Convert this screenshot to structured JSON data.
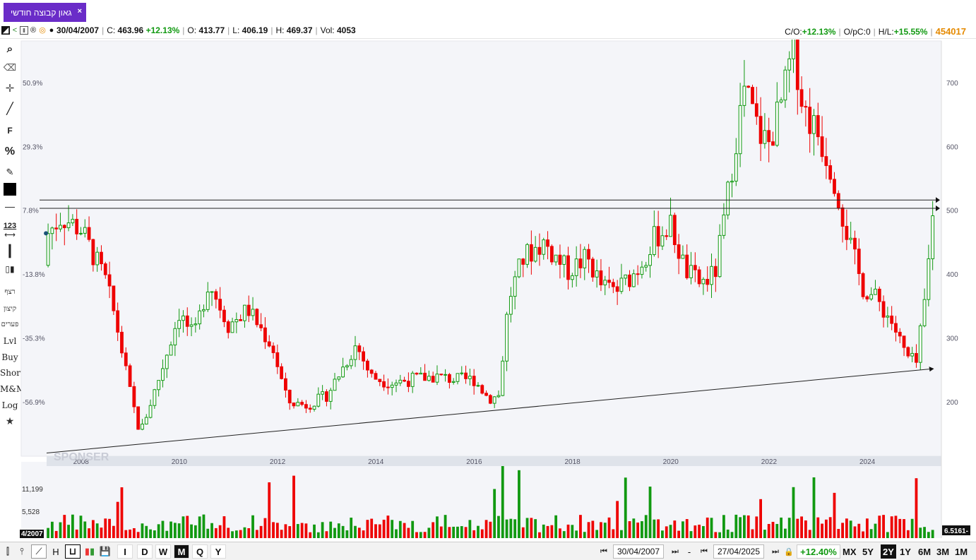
{
  "tab": {
    "title": "גאון קבוצה חודשי",
    "close": "×"
  },
  "info": {
    "date": "30/04/2007",
    "close_label": "C:",
    "close": "463.96",
    "change": "+12.13%",
    "open_label": "O:",
    "open": "413.77",
    "low_label": "L:",
    "low": "406.19",
    "high_label": "H:",
    "high": "469.37",
    "vol_label": "Vol:",
    "vol": "4053",
    "co_label": "C/O:",
    "co": "+12.13%",
    "opc_label": "O/pC:",
    "opc": "0",
    "hl_label": "H/L:",
    "hl": "+15.55%",
    "code": "454017"
  },
  "left_tools": {
    "f": "F",
    "pct": "%",
    "num": "123",
    "hebrew1": "רצף",
    "hebrew2": "קיצון",
    "hebrew3": "פערים",
    "lvl": "Lvl",
    "buy": "Buy",
    "short": "Short",
    "mm": "M&M",
    "log": "Log"
  },
  "chart_data": {
    "type": "candlestick",
    "y_right_ticks": [
      "700",
      "600",
      "500",
      "400",
      "300",
      "200"
    ],
    "y_left_ticks": [
      "50.9%",
      "29.3%",
      "7.8%",
      "-13.8%",
      "-35.3%",
      "-56.9%"
    ],
    "x_ticks": [
      "2008",
      "2010",
      "2012",
      "2014",
      "2016",
      "2018",
      "2020",
      "2022",
      "2024"
    ],
    "volume_ticks": [
      "11,199",
      "5,528"
    ],
    "volume_last": "6.5161-",
    "start_date_label": "4/2007",
    "watermark": "SPONSER",
    "ylim": [
      115,
      765
    ],
    "monthly_close_anchors": [
      [
        2007.33,
        463.96
      ],
      [
        2007.6,
        490
      ],
      [
        2008.0,
        470
      ],
      [
        2008.5,
        390
      ],
      [
        2008.7,
        330
      ],
      [
        2009.0,
        215
      ],
      [
        2009.2,
        150
      ],
      [
        2009.6,
        240
      ],
      [
        2009.8,
        290
      ],
      [
        2010.0,
        340
      ],
      [
        2010.3,
        300
      ],
      [
        2010.6,
        390
      ],
      [
        2011.0,
        320
      ],
      [
        2011.4,
        345
      ],
      [
        2011.9,
        285
      ],
      [
        2012.2,
        200
      ],
      [
        2012.6,
        195
      ],
      [
        2013.0,
        210
      ],
      [
        2013.6,
        290
      ],
      [
        2013.9,
        240
      ],
      [
        2014.3,
        230
      ],
      [
        2014.7,
        235
      ],
      [
        2015.2,
        240
      ],
      [
        2015.6,
        235
      ],
      [
        2016.0,
        235
      ],
      [
        2016.3,
        205
      ],
      [
        2016.5,
        210
      ],
      [
        2016.7,
        360
      ],
      [
        2017.0,
        425
      ],
      [
        2017.4,
        450
      ],
      [
        2017.9,
        405
      ],
      [
        2018.3,
        425
      ],
      [
        2018.6,
        380
      ],
      [
        2018.9,
        375
      ],
      [
        2019.3,
        405
      ],
      [
        2019.7,
        460
      ],
      [
        2020.0,
        475
      ],
      [
        2020.3,
        405
      ],
      [
        2020.6,
        385
      ],
      [
        2020.9,
        400
      ],
      [
        2021.1,
        490
      ],
      [
        2021.3,
        600
      ],
      [
        2021.5,
        690
      ],
      [
        2021.8,
        620
      ],
      [
        2022.0,
        605
      ],
      [
        2022.3,
        680
      ],
      [
        2022.5,
        760
      ],
      [
        2022.7,
        660
      ],
      [
        2023.0,
        620
      ],
      [
        2023.3,
        560
      ],
      [
        2023.6,
        460
      ],
      [
        2023.9,
        380
      ],
      [
        2024.2,
        360
      ],
      [
        2024.5,
        325
      ],
      [
        2024.8,
        270
      ],
      [
        2025.0,
        260
      ],
      [
        2025.2,
        375
      ],
      [
        2025.33,
        500
      ]
    ],
    "horizontal_lines": [
      516,
      503
    ],
    "trendline": [
      [
        2007.3,
        120
      ],
      [
        2025.4,
        252
      ]
    ]
  },
  "bottom": {
    "timeframes": [
      "I",
      "D",
      "W",
      "M",
      "Q",
      "Y"
    ],
    "active_tf": "M",
    "from_date": "30/04/2007",
    "to_sep": "-",
    "to_date": "27/04/2025",
    "period_change": "+12.40%",
    "ranges": [
      "MX",
      "5Y",
      "2Y",
      "1Y",
      "6M",
      "3M",
      "1M"
    ],
    "active_range": "2Y",
    "nav_first": "⏮",
    "nav_last": "⏭"
  },
  "colors": {
    "up": "#119911",
    "down": "#ee0000",
    "accent": "#6a2cc8",
    "grid_bg": "#f4f5f9"
  }
}
